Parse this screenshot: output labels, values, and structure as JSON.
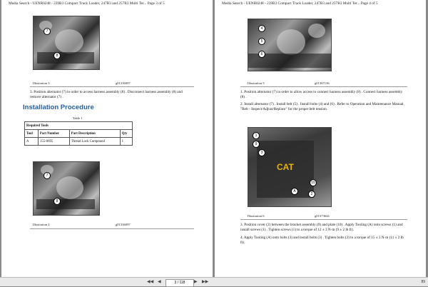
{
  "left_page": {
    "header": "Media Search - UENR0248 - 239B3 Compact Track Loader, 247B3 and 257B3 Multi Ter...   Page 3 of 5",
    "figure1": {
      "caption": "Illustration 3",
      "id": "g01336097",
      "callouts": [
        "7",
        "8"
      ]
    },
    "step": "3.  Position alternator (7) in order to access harness assembly (8) . Disconnect harness assembly (8) and remove alternator (7) .",
    "section_title": "Installation Procedure",
    "table": {
      "caption": "Table 1",
      "title": "Required Tools",
      "headers": [
        "Tool",
        "Part Number",
        "Part Description",
        "Qty"
      ],
      "rows": [
        [
          "A",
          "155-0695",
          "Thread Lock Compound",
          "1"
        ]
      ]
    },
    "figure2": {
      "caption": "Illustration 4",
      "id": "g01336097",
      "callouts": [
        "7",
        "8"
      ]
    }
  },
  "right_page": {
    "header": "Media Search - UENR0248 - 239B3 Compact Track Loader, 247B3 and 257B3 Multi Ter...   Page 4 of 5",
    "figure1": {
      "caption": "Illustration 5",
      "id": "g01367136",
      "callouts": [
        "4",
        "5",
        "6"
      ]
    },
    "steps1": [
      "1.  Position alternator (7) in order to allow access to connect harness assembly (8) . Connect harness assembly (8) .",
      "2.  Install alternator (7) . Install belt (5) . Install bolts (4) and (6) . Refer to Operation and Maintenance Manual, \"Belt - Inspect/Adjust/Replace\" for the proper belt tension."
    ],
    "figure2": {
      "caption": "Illustration 6",
      "id": "g01373644",
      "callouts": [
        "1",
        "9",
        "3",
        "A",
        "10",
        "2"
      ],
      "logo": "CAT"
    },
    "steps2": [
      "3.  Position cover (2) between the bracket assembly (9) and plate (10) . Apply Tooling (A) onto screws (1) and install screws (1) . Tighten screws (1) to a torque of 12 ± 3 N·m (9 ± 2 lb ft).",
      "4.  Apply Tooling (A) onto bolts (3) and install bolts (3) . Tighten bolts (3) to a torque of 15 ± 3 N·m (11 ± 2 lb ft)."
    ]
  },
  "toolbar": {
    "first_label": "◀◀",
    "prev_label": "◀",
    "page_field": "3 / 118",
    "next_label": "▶",
    "last_label": "▶▶",
    "zoom": "89"
  }
}
